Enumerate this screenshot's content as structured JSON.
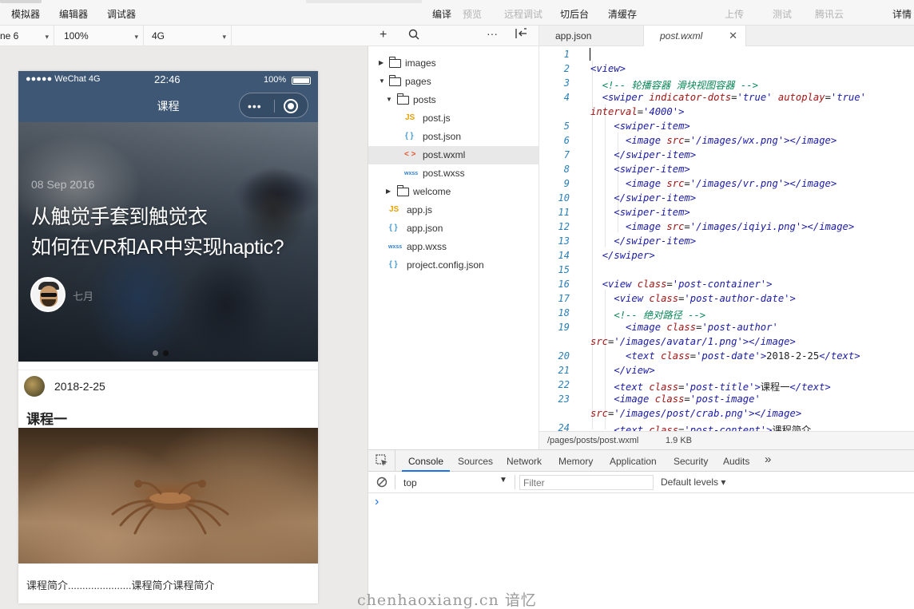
{
  "toolbar": {
    "simulator": "模拟器",
    "editor": "编辑器",
    "debugger": "调试器",
    "compile": "编译",
    "preview": "预览",
    "remote_debug": "远程调试",
    "background": "切后台",
    "clear_cache": "清缓存",
    "upload": "上传",
    "test": "测试",
    "tencent_cloud": "腾讯云",
    "details": "详情"
  },
  "device_bar": {
    "device": "ne 6",
    "zoom": "100%",
    "network": "4G"
  },
  "phone": {
    "carrier": "●●●●● WeChat 4G",
    "time": "22:46",
    "battery": "100%",
    "nav_title": "课程",
    "capsule_dots": "•••",
    "slide": {
      "date": "08 Sep 2016",
      "title_line1": "从触觉手套到触觉衣",
      "title_line2": "如何在VR和AR中实现haptic?",
      "author": "七月"
    },
    "post": {
      "date": "2018-2-25",
      "title": "课程一",
      "content": "课程简介......................课程简介课程简介"
    }
  },
  "file_tree": {
    "items": [
      {
        "name": "images",
        "type": "folder"
      },
      {
        "name": "pages",
        "type": "folder"
      },
      {
        "name": "posts",
        "type": "folder"
      },
      {
        "name": "post.js",
        "icon": "JS"
      },
      {
        "name": "post.json",
        "icon": "{ }"
      },
      {
        "name": "post.wxml",
        "icon": "< >"
      },
      {
        "name": "post.wxss",
        "icon": "wxss"
      },
      {
        "name": "welcome",
        "type": "folder"
      },
      {
        "name": "app.js",
        "icon": "JS"
      },
      {
        "name": "app.json",
        "icon": "{ }"
      },
      {
        "name": "app.wxss",
        "icon": "wxss"
      },
      {
        "name": "project.config.json",
        "icon": "{ }"
      }
    ]
  },
  "editor": {
    "tabs": [
      "app.json",
      "post.wxml"
    ],
    "line_numbers": [
      "1",
      "2",
      "3",
      "4",
      "5",
      "6",
      "7",
      "8",
      "9",
      "10",
      "11",
      "12",
      "13",
      "14",
      "15",
      "16",
      "17",
      "18",
      "19",
      "20",
      "21",
      "22",
      "23",
      "24"
    ],
    "file_path": "/pages/posts/post.wxml",
    "file_size": "1.9 KB"
  },
  "devtools": {
    "tabs": [
      "Console",
      "Sources",
      "Network",
      "Memory",
      "Application",
      "Security",
      "Audits"
    ],
    "more": "»",
    "context": "top",
    "filter_placeholder": "Filter",
    "levels": "Default levels ▾",
    "prompt": "›"
  },
  "watermark": "chenhaoxiang.cn 谙忆",
  "colors": {
    "navbar": "#3d5775",
    "accent": "#1a73e8"
  }
}
